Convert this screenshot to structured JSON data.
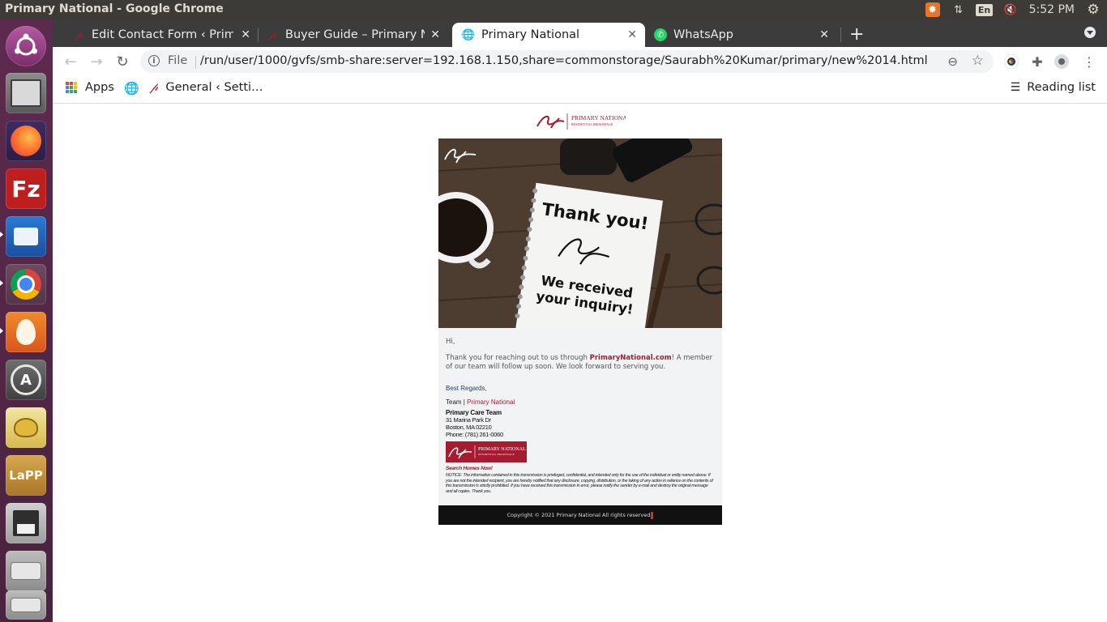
{
  "os": {
    "window_title": "Primary National - Google Chrome",
    "keyboard_layout": "En",
    "clock": "5:52 PM"
  },
  "launcher": {
    "items": [
      "ubuntu-dash-icon",
      "files-icon",
      "firefox-icon",
      "filezilla-icon",
      "thunderbird-icon",
      "chrome-icon",
      "xampp-icon",
      "software-updater-icon",
      "teapot-icon",
      "lampp-icon",
      "save-icon",
      "drive-icon",
      "drive-icon-2"
    ]
  },
  "tabs": [
    {
      "title": "Edit Contact Form ‹ Prima",
      "favicon": "pn-logo-icon"
    },
    {
      "title": "Buyer Guide – Primary Na",
      "favicon": "pn-logo-icon"
    },
    {
      "title": "Primary National",
      "favicon": "globe-icon",
      "active": true
    },
    {
      "title": "WhatsApp",
      "favicon": "whatsapp-icon"
    }
  ],
  "toolbar": {
    "scheme_label": "File",
    "url": "/run/user/1000/gvfs/smb-share:server=192.168.1.150,share=commonstorage/Saurabh%20Kumar/primary/new%2014.html"
  },
  "bookmarks": {
    "apps_label": "Apps",
    "items": [
      {
        "label": "General ‹ Setti…"
      }
    ],
    "reading_list": "Reading list"
  },
  "email": {
    "logo_brand": "PRIMARY NATIONAL",
    "logo_sub": "RESIDENTIAL BROKERAGE",
    "hero": {
      "line1": "Thank you!",
      "line2": "We received",
      "line3": "your inquiry!"
    },
    "greeting": "Hi,",
    "message_before": "Thank you for reaching out to us through ",
    "message_link": "PrimaryNational.com",
    "message_after": "! A member of our team will follow up soon. We look forward to serving you.",
    "regards": "Best Regards,",
    "team_prefix": "Team | ",
    "team_brand": "Primary National",
    "signature": {
      "name": "Primary Care Team",
      "address1": "31 Marina Park Dr",
      "address2": "Boston, MA 02210",
      "phone": "Phone: (781) 261-0060"
    },
    "search_link": "Search Homes Now!",
    "notice": "NOTICE: The information contained in this transmission is privileged, confidential, and intended only for the use of the individual or entity named above. If you are not the intended recipient, you are hereby notified that any disclosure, copying, distribution, or the taking of any action in reliance on the contents of this transmission is strictly prohibited. If you have received this transmission in error, please notify the sender by e-mail and destroy the original message and all copies. Thank you.",
    "copyright": "Copyright © 2021 Primary National All rights reserved"
  },
  "colors": {
    "brand_red": "#a51c30",
    "ubuntu_panel": "#3c3b37",
    "launcher": "#5d2a4e",
    "tabstrip": "#3c3c3c"
  }
}
